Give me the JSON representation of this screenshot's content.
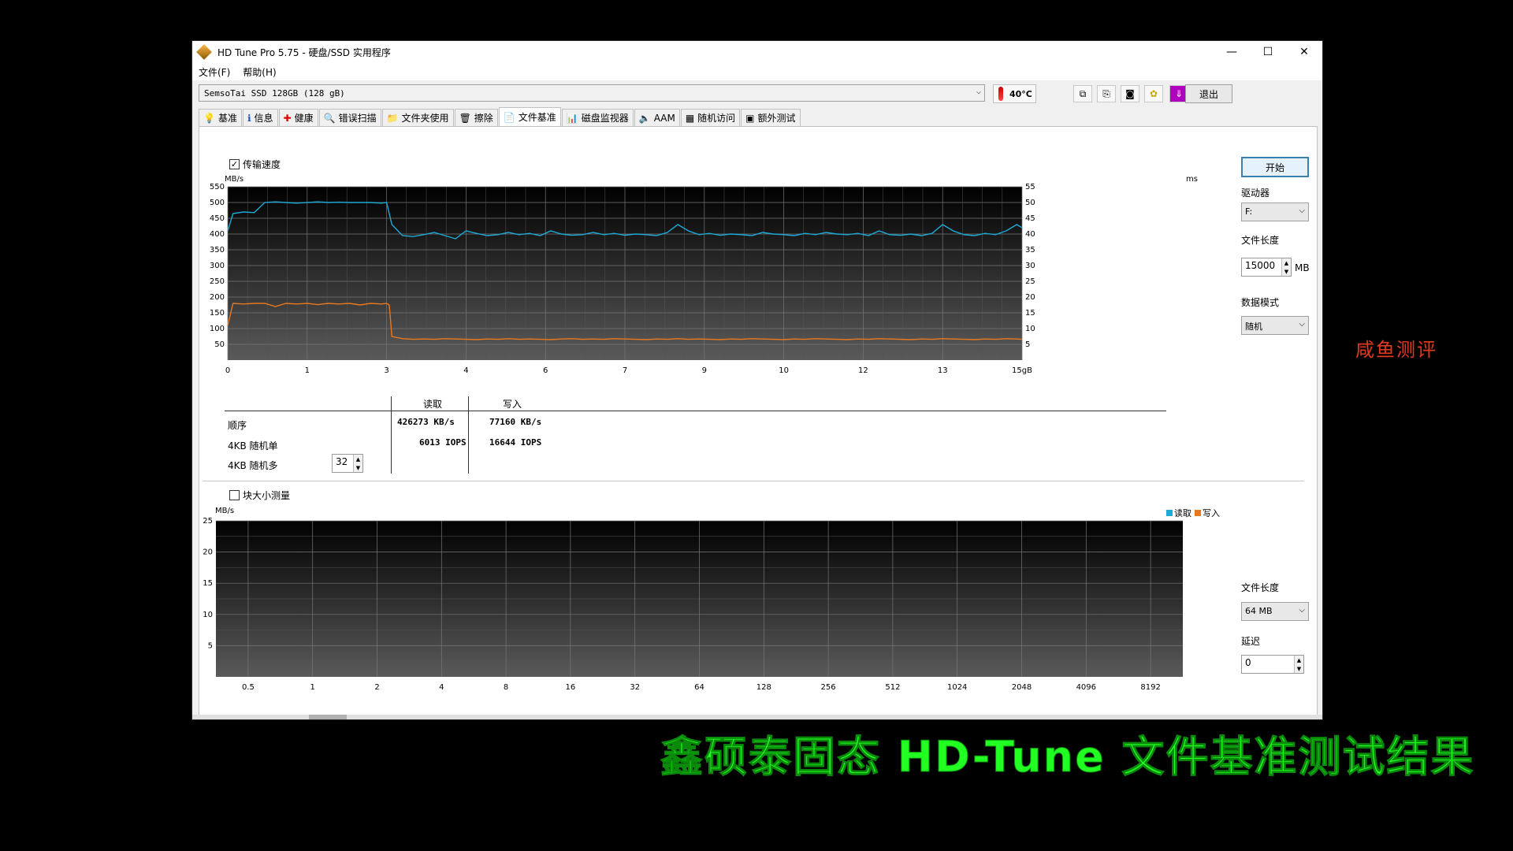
{
  "window": {
    "title": "HD Tune Pro 5.75 - 硬盘/SSD 实用程序",
    "minimize": "—",
    "maximize": "☐",
    "close": "✕"
  },
  "menu": [
    "文件(F)",
    "帮助(H)"
  ],
  "toolbar": {
    "drive": "SemsoTai SSD 128GB (128 gB)",
    "temperature": "40°C",
    "exit": "退出"
  },
  "tabs": [
    {
      "label": "基准",
      "icon": "💡"
    },
    {
      "label": "信息",
      "icon": "ℹ"
    },
    {
      "label": "健康",
      "icon": "✚"
    },
    {
      "label": "错误扫描",
      "icon": "🔍"
    },
    {
      "label": "文件夹使用",
      "icon": "📁"
    },
    {
      "label": "擦除",
      "icon": "🗑"
    },
    {
      "label": "文件基准",
      "icon": "📄"
    },
    {
      "label": "磁盘监视器",
      "icon": "📊"
    },
    {
      "label": "AAM",
      "icon": "🔈"
    },
    {
      "label": "随机访问",
      "icon": "▦"
    },
    {
      "label": "额外测试",
      "icon": "▣"
    }
  ],
  "transfer": {
    "checkbox_label": "传输速度",
    "checked": "✓",
    "y_unit": "MB/s",
    "y2_unit": "ms",
    "y_ticks": [
      "550",
      "500",
      "450",
      "400",
      "350",
      "300",
      "250",
      "200",
      "150",
      "100",
      "50"
    ],
    "y2_ticks": [
      "55",
      "50",
      "45",
      "40",
      "35",
      "30",
      "25",
      "20",
      "15",
      "10",
      "5"
    ],
    "x_ticks": [
      "0",
      "1",
      "3",
      "4",
      "6",
      "7",
      "9",
      "10",
      "12",
      "13",
      "15gB"
    ]
  },
  "results": {
    "header_read": "读取",
    "header_write": "写入",
    "rows": [
      {
        "label": "顺序",
        "read": "426273 KB/s",
        "write": "77160 KB/s"
      },
      {
        "label": "4KB 随机单",
        "read": "6013 IOPS",
        "write": "16644 IOPS"
      },
      {
        "label": "4KB 随机多",
        "read": "",
        "write": ""
      }
    ],
    "queue_depth": "32"
  },
  "blocksize": {
    "checkbox_label": "块大小测量",
    "y_unit": "MB/s",
    "y_ticks": [
      "25",
      "20",
      "15",
      "10",
      "5"
    ],
    "x_ticks": [
      "0.5",
      "1",
      "2",
      "4",
      "8",
      "16",
      "32",
      "64",
      "128",
      "256",
      "512",
      "1024",
      "2048",
      "4096",
      "8192"
    ],
    "legend_read": "读取",
    "legend_write": "写入"
  },
  "sidebar": {
    "start": "开始",
    "drive_label": "驱动器",
    "drive_value": "F:",
    "file_length_label": "文件长度",
    "file_length_value": "15000",
    "file_length_unit": "MB",
    "data_mode_label": "数据模式",
    "data_mode_value": "随机",
    "file_length2_label": "文件长度",
    "file_length2_value": "64 MB",
    "delay_label": "延迟",
    "delay_value": "0"
  },
  "overlay": {
    "watermark": "咸鱼测评",
    "caption": "鑫硕泰固态 HD-Tune 文件基准测试结果"
  },
  "colors": {
    "read": "#1eaad8",
    "write": "#e8781e"
  },
  "chart_data": [
    {
      "type": "line",
      "ylabel": "MB/s",
      "ylim": [
        0,
        550
      ],
      "xlim": [
        0,
        15
      ],
      "grid": true,
      "series": [
        {
          "name": "读取",
          "x": [
            0,
            0.1,
            0.3,
            0.5,
            0.7,
            0.9,
            1.1,
            1.3,
            1.5,
            1.7,
            1.9,
            2.1,
            2.3,
            2.5,
            2.7,
            2.9,
            3.0,
            3.1,
            3.3,
            3.5,
            3.7,
            3.9,
            4.1,
            4.3,
            4.5,
            4.7,
            4.9,
            5.1,
            5.3,
            5.5,
            5.7,
            5.9,
            6.1,
            6.3,
            6.5,
            6.7,
            6.9,
            7.1,
            7.3,
            7.5,
            7.7,
            7.9,
            8.1,
            8.3,
            8.5,
            8.7,
            8.9,
            9.1,
            9.3,
            9.5,
            9.7,
            9.9,
            10.1,
            10.3,
            10.5,
            10.7,
            10.9,
            11.1,
            11.3,
            11.5,
            11.7,
            11.9,
            12.1,
            12.3,
            12.5,
            12.7,
            12.9,
            13.1,
            13.3,
            13.5,
            13.7,
            13.9,
            14.1,
            14.3,
            14.5,
            14.7,
            14.9,
            15
          ],
          "y": [
            410,
            465,
            470,
            468,
            500,
            502,
            500,
            498,
            500,
            502,
            500,
            501,
            500,
            500,
            500,
            498,
            500,
            430,
            395,
            392,
            398,
            405,
            395,
            385,
            410,
            402,
            395,
            398,
            405,
            398,
            402,
            395,
            410,
            400,
            396,
            398,
            405,
            398,
            402,
            396,
            400,
            398,
            395,
            405,
            430,
            410,
            398,
            402,
            396,
            400,
            398,
            395,
            405,
            400,
            398,
            395,
            402,
            398,
            405,
            400,
            398,
            402,
            395,
            410,
            398,
            396,
            400,
            395,
            402,
            430,
            410,
            398,
            395,
            402,
            398,
            410,
            430,
            420
          ]
        },
        {
          "name": "写入",
          "x": [
            0,
            0.1,
            0.3,
            0.5,
            0.7,
            0.9,
            1.1,
            1.3,
            1.5,
            1.7,
            1.9,
            2.1,
            2.3,
            2.5,
            2.7,
            2.9,
            3.0,
            3.05,
            3.1,
            3.3,
            3.5,
            3.7,
            3.9,
            4.1,
            4.3,
            4.5,
            4.7,
            4.9,
            5.1,
            5.3,
            5.5,
            5.7,
            5.9,
            6.1,
            6.3,
            6.5,
            6.7,
            6.9,
            7.1,
            7.3,
            7.5,
            7.7,
            7.9,
            8.1,
            8.3,
            8.5,
            8.7,
            8.9,
            9.1,
            9.3,
            9.5,
            9.7,
            9.9,
            10.1,
            10.3,
            10.5,
            10.7,
            10.9,
            11.1,
            11.3,
            11.5,
            11.7,
            11.9,
            12.1,
            12.3,
            12.5,
            12.7,
            12.9,
            13.1,
            13.3,
            13.5,
            13.7,
            13.9,
            14.1,
            14.3,
            14.5,
            14.7,
            14.9,
            15
          ],
          "y": [
            110,
            180,
            178,
            180,
            180,
            170,
            180,
            178,
            180,
            176,
            180,
            178,
            180,
            175,
            180,
            178,
            180,
            175,
            75,
            68,
            66,
            67,
            66,
            68,
            67,
            66,
            65,
            67,
            66,
            68,
            66,
            67,
            66,
            65,
            67,
            68,
            66,
            67,
            66,
            68,
            67,
            66,
            65,
            67,
            66,
            68,
            66,
            67,
            66,
            65,
            67,
            66,
            68,
            67,
            66,
            65,
            67,
            66,
            68,
            67,
            66,
            65,
            67,
            66,
            68,
            67,
            66,
            65,
            67,
            66,
            68,
            67,
            66,
            65,
            67,
            66,
            68,
            67,
            66
          ]
        }
      ]
    },
    {
      "type": "line",
      "ylabel": "MB/s",
      "ylim": [
        0,
        25
      ],
      "categories": [
        "0.5",
        "1",
        "2",
        "4",
        "8",
        "16",
        "32",
        "64",
        "128",
        "256",
        "512",
        "1024",
        "2048",
        "4096",
        "8192"
      ],
      "grid": true,
      "legend": "top-right",
      "series": [
        {
          "name": "读取",
          "values": []
        },
        {
          "name": "写入",
          "values": []
        }
      ]
    }
  ]
}
